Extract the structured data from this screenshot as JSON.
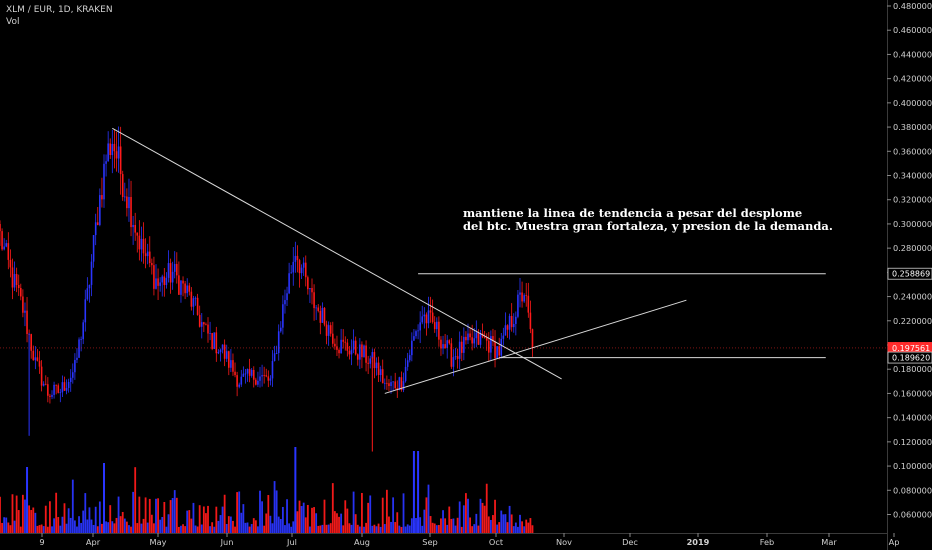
{
  "header": {
    "title": "XLM / EUR, 1D, KRAKEN",
    "volume_label": "Vol"
  },
  "annotation": {
    "line1": "mantiene la linea de tendencia a pesar del desplome",
    "line2": "del btc. Muestra gran fortaleza, y presion de la demanda."
  },
  "colors": {
    "background": "#000000",
    "up": "#2a35ff",
    "down": "#ff1a1a",
    "trendline": "#d9d9d9",
    "price_line": "#ff2b2b",
    "axis_text": "#d0d0d0"
  },
  "chart_data": {
    "type": "candlestick",
    "title": "XLM / EUR, 1D, KRAKEN",
    "x_ticks": [
      "9",
      "Apr",
      "May",
      "Jun",
      "Jul",
      "Aug",
      "Sep",
      "Oct",
      "Nov",
      "Dec",
      "2019",
      "Feb",
      "Mar",
      "Ap"
    ],
    "y_ticks": [
      "0.480000",
      "0.460000",
      "0.440000",
      "0.420000",
      "0.400000",
      "0.380000",
      "0.360000",
      "0.340000",
      "0.320000",
      "0.300000",
      "0.280000",
      "0.260000",
      "0.240000",
      "0.220000",
      "0.200000",
      "0.180000",
      "0.160000",
      "0.140000",
      "0.120000",
      "0.100000",
      "0.080000",
      "0.060000"
    ],
    "ylim": [
      0.053,
      0.484
    ],
    "price_labels": {
      "resistance": "0.258869",
      "last": "0.197561",
      "support": "0.189620"
    },
    "resistance_level": 0.258869,
    "last_price": 0.197561,
    "support_level": 0.18962,
    "price_path": [
      [
        "2018-03-07",
        0.29
      ],
      [
        "2018-03-12",
        0.26
      ],
      [
        "2018-03-18",
        0.23
      ],
      [
        "2018-03-24",
        0.185
      ],
      [
        "2018-03-30",
        0.16
      ],
      [
        "2018-04-05",
        0.162
      ],
      [
        "2018-04-12",
        0.18
      ],
      [
        "2018-04-18",
        0.24
      ],
      [
        "2018-04-23",
        0.31
      ],
      [
        "2018-04-27",
        0.355
      ],
      [
        "2018-04-30",
        0.37
      ],
      [
        "2018-05-06",
        0.33
      ],
      [
        "2018-05-14",
        0.28
      ],
      [
        "2018-05-22",
        0.25
      ],
      [
        "2018-05-29",
        0.26
      ],
      [
        "2018-06-06",
        0.24
      ],
      [
        "2018-06-14",
        0.21
      ],
      [
        "2018-06-22",
        0.195
      ],
      [
        "2018-06-30",
        0.17
      ],
      [
        "2018-07-08",
        0.175
      ],
      [
        "2018-07-15",
        0.17
      ],
      [
        "2018-07-21",
        0.23
      ],
      [
        "2018-07-27",
        0.28
      ],
      [
        "2018-08-03",
        0.24
      ],
      [
        "2018-08-10",
        0.22
      ],
      [
        "2018-08-17",
        0.2
      ],
      [
        "2018-08-26",
        0.195
      ],
      [
        "2018-09-03",
        0.185
      ],
      [
        "2018-09-09",
        0.165
      ],
      [
        "2018-09-16",
        0.17
      ],
      [
        "2018-09-21",
        0.2
      ],
      [
        "2018-09-26",
        0.225
      ],
      [
        "2018-10-02",
        0.215
      ],
      [
        "2018-10-10",
        0.19
      ],
      [
        "2018-10-17",
        0.2
      ],
      [
        "2018-10-25",
        0.205
      ],
      [
        "2018-11-02",
        0.195
      ],
      [
        "2018-11-09",
        0.225
      ],
      [
        "2018-11-14",
        0.245
      ],
      [
        "2018-11-18",
        0.1975
      ]
    ],
    "trendlines": [
      {
        "name": "descending",
        "from": [
          "2018-04-30",
          0.379
        ],
        "to": [
          "2018-12-02",
          0.172
        ]
      },
      {
        "name": "ascending",
        "from": [
          "2018-09-08",
          0.16
        ],
        "to": [
          "2019-01-31",
          0.237
        ]
      },
      {
        "name": "resistance",
        "from": [
          "2018-09-24",
          0.258869
        ],
        "to": [
          "2019-04-08",
          0.258869
        ]
      },
      {
        "name": "support",
        "from": [
          "2018-11-02",
          0.18962
        ],
        "to": [
          "2019-04-08",
          0.18962
        ]
      }
    ],
    "volume": {
      "ylim": [
        0,
        0.125
      ]
    }
  }
}
